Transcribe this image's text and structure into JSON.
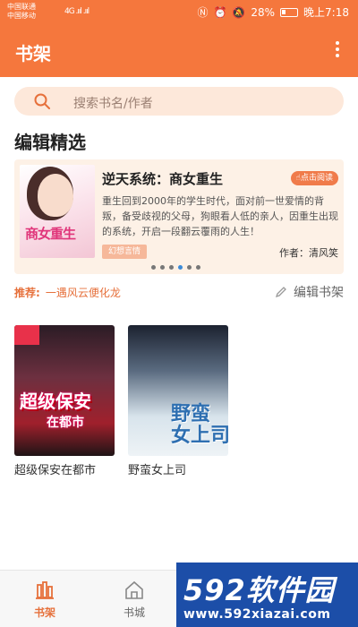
{
  "status_bar": {
    "carrier_1": "中国联通",
    "carrier_2": "中国移动",
    "signal": "4G .ııl .ııl",
    "battery": "28%",
    "time": "晚上7:18",
    "icons": [
      "nfc-icon",
      "alarm-icon",
      "mute-icon",
      "battery-icon",
      "wifi-icon"
    ]
  },
  "app_bar": {
    "title": "书架",
    "more_icon": "more-vertical-icon"
  },
  "search": {
    "placeholder": "搜索书名/作者"
  },
  "editors_pick": {
    "title": "编辑精选",
    "featured": {
      "cover_text": "商女重生",
      "tag": "幻想言情",
      "title": "逆天系统：商女重生",
      "read_button": "点击阅读",
      "description": "重生回到2000年的学生时代，面对前一世爱情的背叛，备受歧视的父母，狗眼看人低的亲人，因重生出现的系统，开启一段翻云覆雨的人生！",
      "author": "作者：清风笑"
    },
    "carousel": {
      "count": 6,
      "active_index": 4
    }
  },
  "recommend": {
    "label": "推荐:",
    "text": "一遇风云便化龙"
  },
  "edit_shelf": {
    "label": "编辑书架"
  },
  "books": [
    {
      "title": "超级保安在都市",
      "cover_title": "超级保安",
      "cover_sub": "在都市"
    },
    {
      "title": "野蛮女上司",
      "cover_title": "野蛮\n女上司"
    }
  ],
  "tab_bar": {
    "tabs": [
      {
        "label": "书架",
        "active": true
      },
      {
        "label": "书城",
        "active": false
      }
    ],
    "accent": "#e6703b"
  },
  "watermark": {
    "big": "592软件园",
    "small": "www.592xiazai.com"
  },
  "colors": {
    "primary": "#f5773d",
    "search_bg": "#fde8da",
    "featured_bg": "#fdf1e6"
  }
}
